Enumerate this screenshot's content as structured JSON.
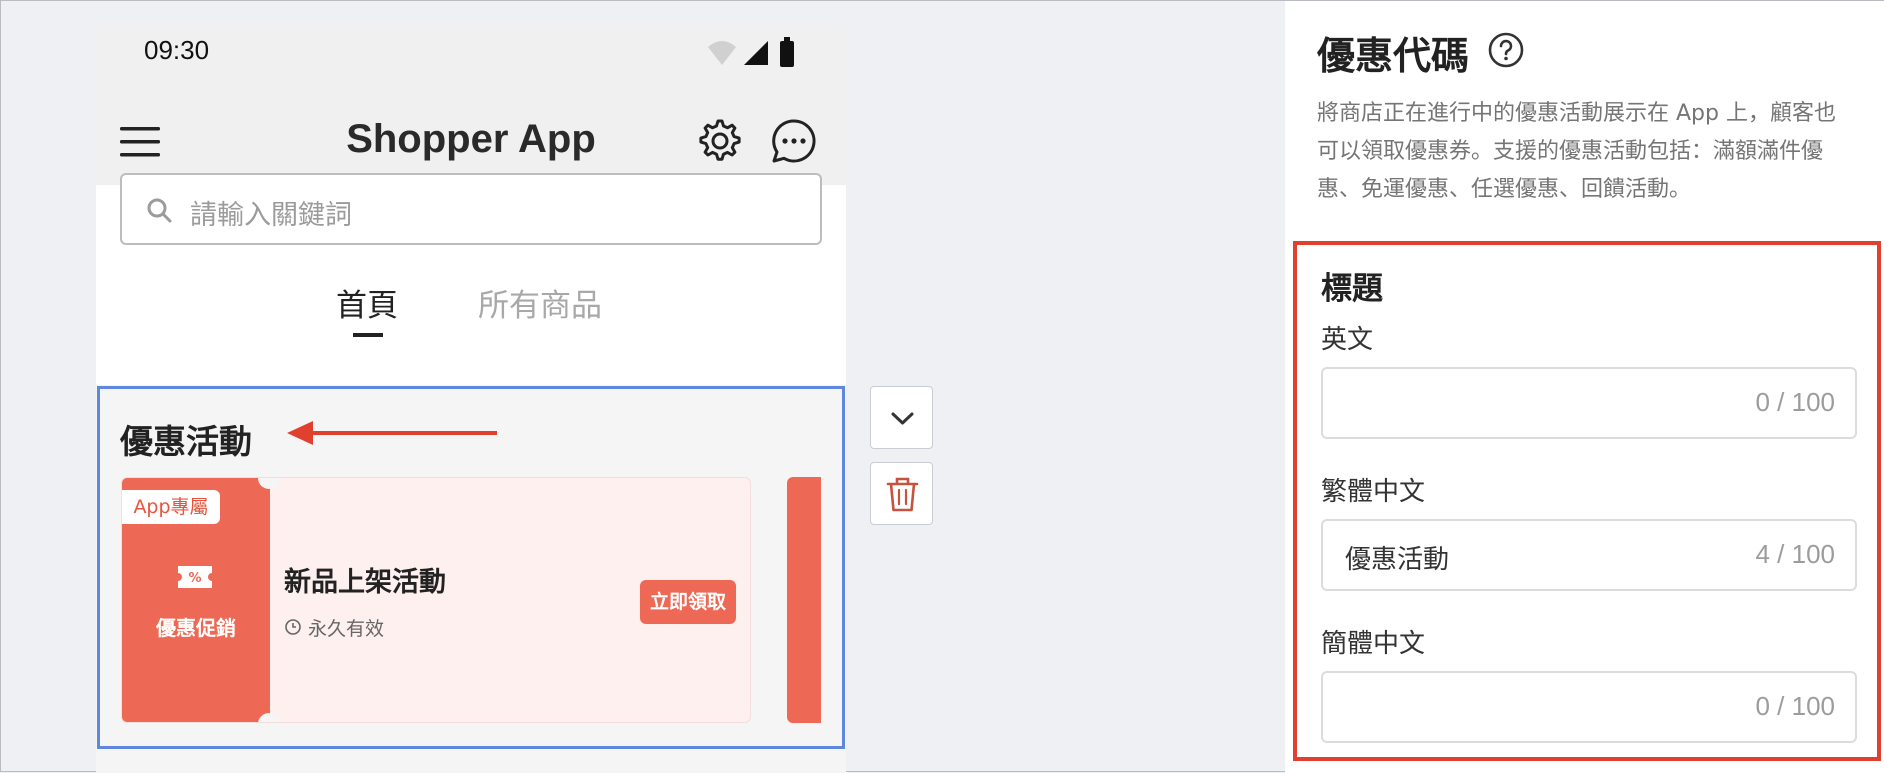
{
  "phone": {
    "status_time": "09:30",
    "app_title": "Shopper App",
    "search_placeholder": "請輸入關鍵詞",
    "tabs": [
      {
        "label": "首頁",
        "active": true
      },
      {
        "label": "所有商品",
        "active": false
      }
    ],
    "promo_section": {
      "title": "優惠活動",
      "coupon": {
        "badge": "App專屬",
        "type_label": "優惠促銷",
        "name": "新品上架活動",
        "validity": "永久有效",
        "claim_label": "立即領取"
      }
    }
  },
  "panel": {
    "title": "優惠代碼",
    "description": "將商店正在進行中的優惠活動展示在 App 上，顧客也可以領取優惠券。支援的優惠活動包括：滿額滿件優惠、免運優惠、任選優惠、回饋活動。",
    "section_title": "標題",
    "fields": [
      {
        "label": "英文",
        "value": "",
        "counter": "0 / 100"
      },
      {
        "label": "繁體中文",
        "value": "優惠活動",
        "counter": "4 / 100"
      },
      {
        "label": "簡體中文",
        "value": "",
        "counter": "0 / 100"
      }
    ]
  },
  "colors": {
    "accent_coupon": "#ee6955",
    "selection_outline": "#5f86e0",
    "highlight_outline": "#e1402f",
    "annotation_arrow": "#e1402f"
  },
  "icons": [
    "wifi-icon",
    "signal-icon",
    "battery-icon",
    "menu-icon",
    "gear-icon",
    "chat-icon",
    "search-icon",
    "ticket-icon",
    "clock-icon",
    "chevron-down-icon",
    "trash-icon",
    "help-icon",
    "arrow-left-icon"
  ]
}
